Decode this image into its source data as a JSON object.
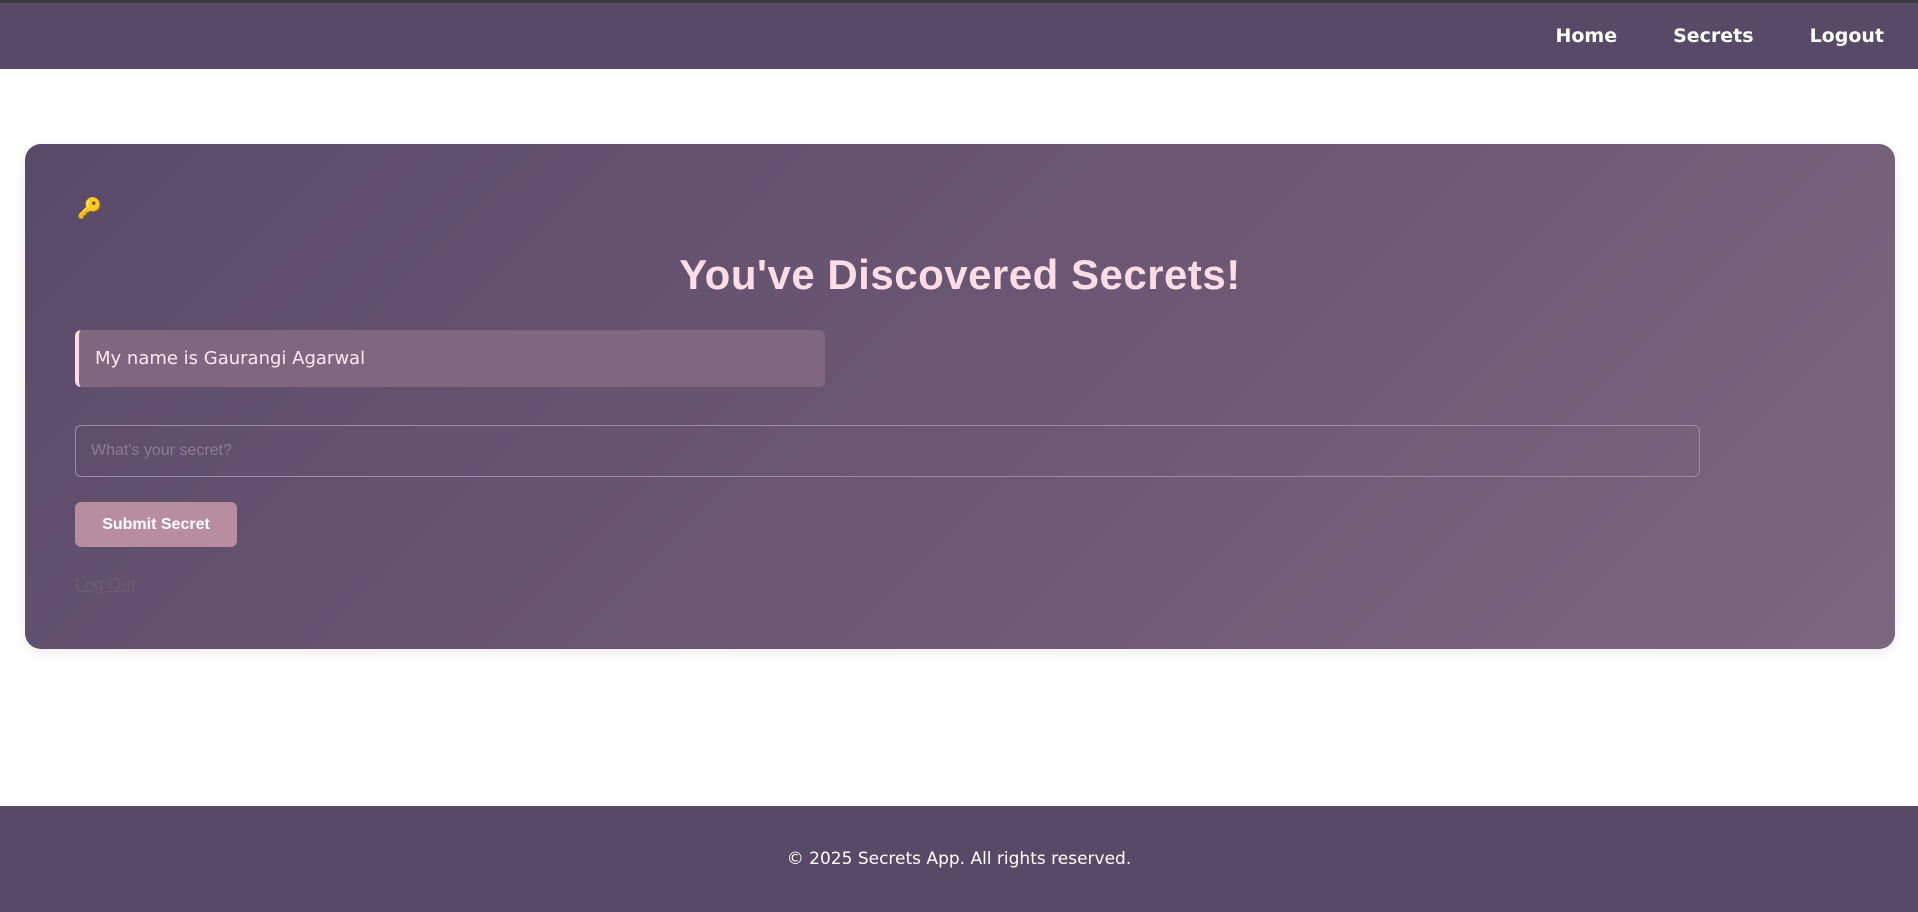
{
  "nav": {
    "items": [
      {
        "label": "Home"
      },
      {
        "label": "Secrets"
      },
      {
        "label": "Logout"
      }
    ]
  },
  "card": {
    "icon": "key-icon",
    "title": "You've Discovered Secrets!",
    "secret_text": "My name is Gaurangi Agarwal",
    "input": {
      "placeholder": "What's your secret?",
      "value": ""
    },
    "submit_label": "Submit Secret",
    "logout_label": "Log Out"
  },
  "footer": {
    "text": "© 2025 Secrets App. All rights reserved."
  },
  "colors": {
    "nav_bg": "#584967",
    "card_gradient_start": "#5a4a69",
    "card_gradient_end": "#7d667f",
    "title": "#ffdce6",
    "button": "#b78d9f"
  }
}
